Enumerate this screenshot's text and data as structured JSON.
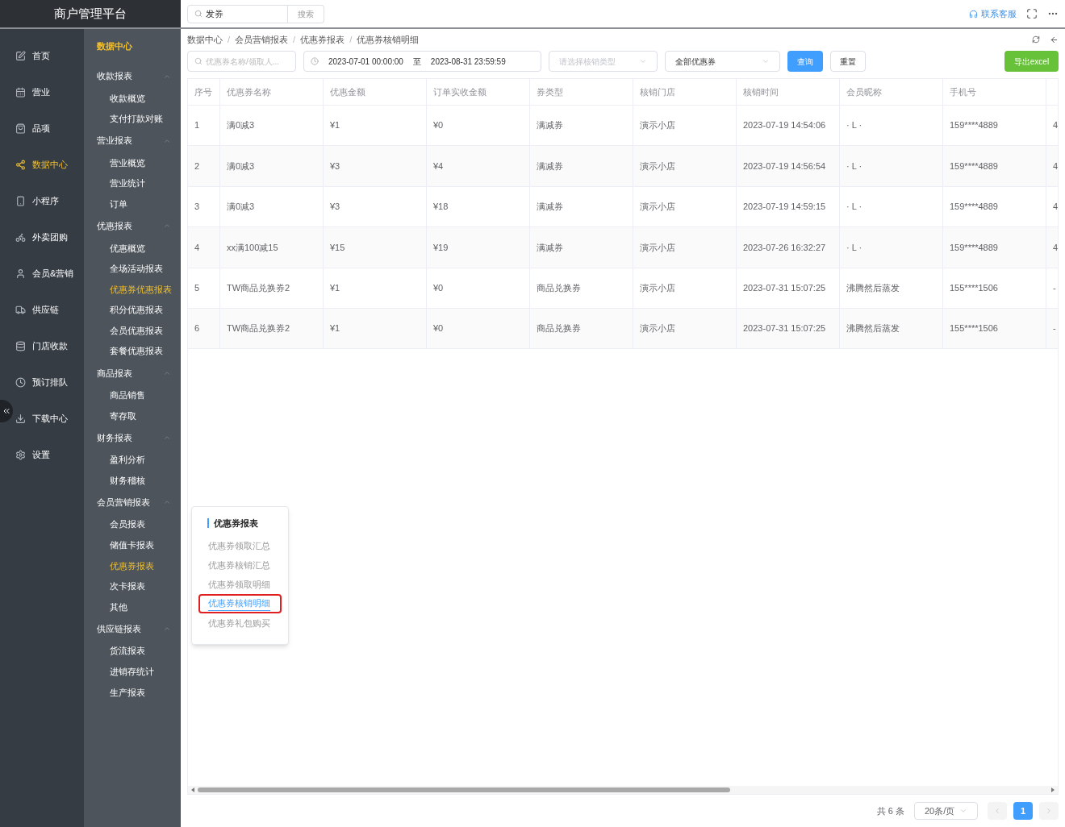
{
  "app": {
    "title": "商户管理平台"
  },
  "header": {
    "search": {
      "value": "发券"
    },
    "search_button": "搜索",
    "contact": "联系客服"
  },
  "nav": [
    {
      "label": "首页",
      "selected": false
    },
    {
      "label": "营业",
      "selected": false
    },
    {
      "label": "品项",
      "selected": false
    },
    {
      "label": "数据中心",
      "selected": true
    },
    {
      "label": "小程序",
      "selected": false
    },
    {
      "label": "外卖团购",
      "selected": false
    },
    {
      "label": "会员&营销",
      "selected": false
    },
    {
      "label": "供应链",
      "selected": false
    },
    {
      "label": "门店收款",
      "selected": false
    },
    {
      "label": "预订排队",
      "selected": false
    },
    {
      "label": "下载中心",
      "selected": false
    },
    {
      "label": "设置",
      "selected": false
    }
  ],
  "submenu": {
    "title": "数据中心",
    "groups": [
      {
        "label": "收款报表",
        "expanded": true,
        "children": [
          {
            "label": "收款概览",
            "selected": false
          },
          {
            "label": "支付打款对账",
            "selected": false
          }
        ]
      },
      {
        "label": "营业报表",
        "expanded": true,
        "children": [
          {
            "label": "营业概览",
            "selected": false
          },
          {
            "label": "营业统计",
            "selected": false
          },
          {
            "label": "订单",
            "selected": false
          }
        ]
      },
      {
        "label": "优惠报表",
        "expanded": true,
        "children": [
          {
            "label": "优惠概览",
            "selected": false
          },
          {
            "label": "全场活动报表",
            "selected": false
          },
          {
            "label": "优惠券优惠报表",
            "selected": true
          },
          {
            "label": "积分优惠报表",
            "selected": false
          },
          {
            "label": "会员优惠报表",
            "selected": false
          },
          {
            "label": "套餐优惠报表",
            "selected": false
          }
        ]
      },
      {
        "label": "商品报表",
        "expanded": true,
        "children": [
          {
            "label": "商品销售",
            "selected": false
          },
          {
            "label": "寄存取",
            "selected": false
          }
        ]
      },
      {
        "label": "财务报表",
        "expanded": true,
        "children": [
          {
            "label": "盈利分析",
            "selected": false
          },
          {
            "label": "财务稽核",
            "selected": false
          }
        ]
      },
      {
        "label": "会员营销报表",
        "expanded": true,
        "children": [
          {
            "label": "会员报表",
            "selected": false
          },
          {
            "label": "储值卡报表",
            "selected": false
          },
          {
            "label": "优惠券报表",
            "selected": true
          },
          {
            "label": "次卡报表",
            "selected": false
          },
          {
            "label": "其他",
            "selected": false
          }
        ]
      },
      {
        "label": "供应链报表",
        "expanded": true,
        "children": [
          {
            "label": "货流报表",
            "selected": false
          },
          {
            "label": "进销存统计",
            "selected": false
          },
          {
            "label": "生产报表",
            "selected": false
          }
        ]
      }
    ]
  },
  "breadcrumb": [
    "数据中心",
    "会员营销报表",
    "优惠券报表",
    "优惠券核销明细"
  ],
  "breadcrumb_separator": "/",
  "filters": {
    "search": {
      "placeholder": "优惠券名称/领取人..."
    },
    "start": "2023-07-01 00:00:00",
    "separator": "至",
    "end": "2023-08-31 23:59:59",
    "type_select": {
      "placeholder": "请选择核销类型"
    },
    "coupon_select": {
      "value": "全部优惠券"
    },
    "query_button": "查询",
    "reset_button": "重置",
    "export_button": "导出excel"
  },
  "table": {
    "columns": [
      "序号",
      "优惠券名称",
      "优惠金额",
      "订单实收金额",
      "券类型",
      "核销门店",
      "核销时间",
      "会员昵称",
      "手机号"
    ],
    "rows": [
      [
        "1",
        "满0减3",
        "¥1",
        "¥0",
        "满减券",
        "演示小店",
        "2023-07-19 14:54:06",
        "· L ·",
        "159****4889",
        "4"
      ],
      [
        "2",
        "满0减3",
        "¥3",
        "¥4",
        "满减券",
        "演示小店",
        "2023-07-19 14:56:54",
        "· L ·",
        "159****4889",
        "4"
      ],
      [
        "3",
        "满0减3",
        "¥3",
        "¥18",
        "满减券",
        "演示小店",
        "2023-07-19 14:59:15",
        "· L ·",
        "159****4889",
        "4"
      ],
      [
        "4",
        "xx满100减15",
        "¥15",
        "¥19",
        "满减券",
        "演示小店",
        "2023-07-26 16:32:27",
        "· L ·",
        "159****4889",
        "4"
      ],
      [
        "5",
        "TW商品兑换券2",
        "¥1",
        "¥0",
        "商品兑换券",
        "演示小店",
        "2023-07-31 15:07:25",
        "沸腾然后蒸发",
        "155****1506",
        "-"
      ],
      [
        "6",
        "TW商品兑换券2",
        "¥1",
        "¥0",
        "商品兑换券",
        "演示小店",
        "2023-07-31 15:07:25",
        "沸腾然后蒸发",
        "155****1506",
        "-"
      ]
    ]
  },
  "popover": {
    "title": "优惠券报表",
    "items": [
      {
        "label": "优惠券领取汇总",
        "selected": false
      },
      {
        "label": "优惠券核销汇总",
        "selected": false
      },
      {
        "label": "优惠券领取明细",
        "selected": false
      },
      {
        "label": "优惠券核销明细",
        "selected": true
      },
      {
        "label": "优惠券礼包购买",
        "selected": false
      }
    ]
  },
  "pagination": {
    "total": "共 6 条",
    "page_size": "20条/页",
    "pages": [
      {
        "label": "1",
        "selected": true
      }
    ]
  }
}
